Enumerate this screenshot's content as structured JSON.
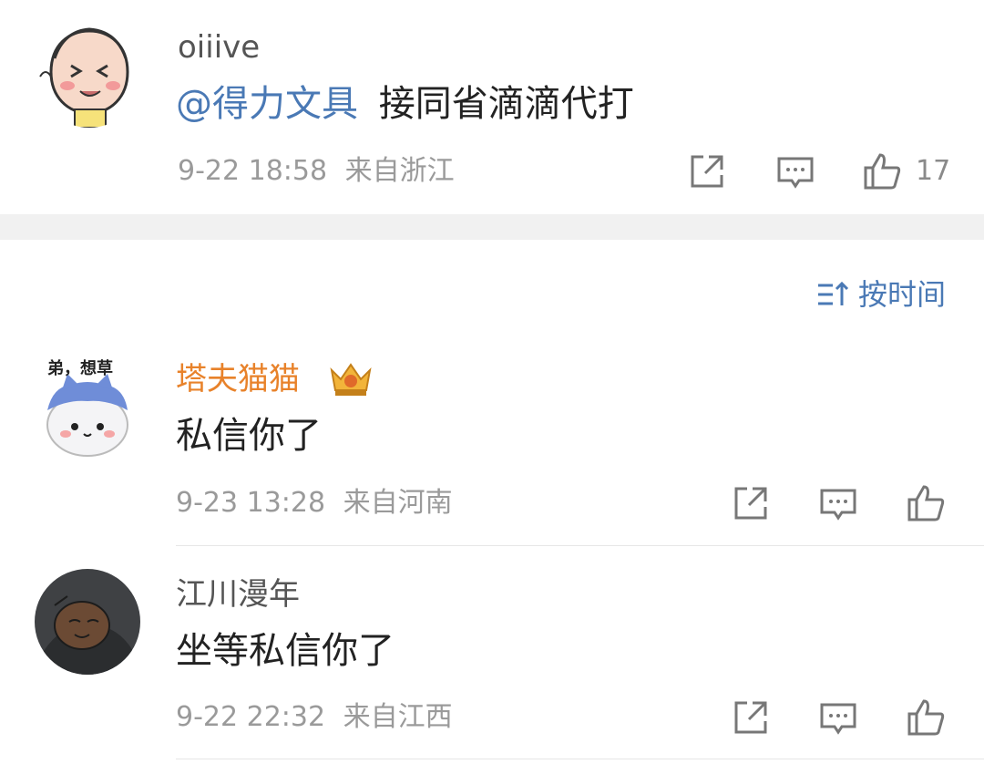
{
  "comments_top": [
    {
      "username": "oiiive",
      "mention": "@得力文具",
      "text": "接同省滴滴代打",
      "time": "9-22 18:58",
      "location": "来自浙江",
      "likes": "17"
    }
  ],
  "sort": {
    "label": "按时间",
    "icon": "sort-icon"
  },
  "comments": [
    {
      "username": "塔夫猫猫",
      "avatar_caption": "弟，想草",
      "text": "私信你了",
      "time": "9-23 13:28",
      "location": "来自河南",
      "likes": ""
    },
    {
      "username": "江川漫年",
      "text": "坐等私信你了",
      "time": "9-22 22:32",
      "location": "来自江西",
      "likes": ""
    }
  ],
  "icons": [
    "share-icon",
    "comment-icon",
    "like-icon",
    "vip-crown-icon"
  ],
  "colors": {
    "mention": "#4a79b5",
    "vip_name": "#e8822a",
    "meta": "#9a9a9a",
    "band": "#f1f1f1"
  }
}
